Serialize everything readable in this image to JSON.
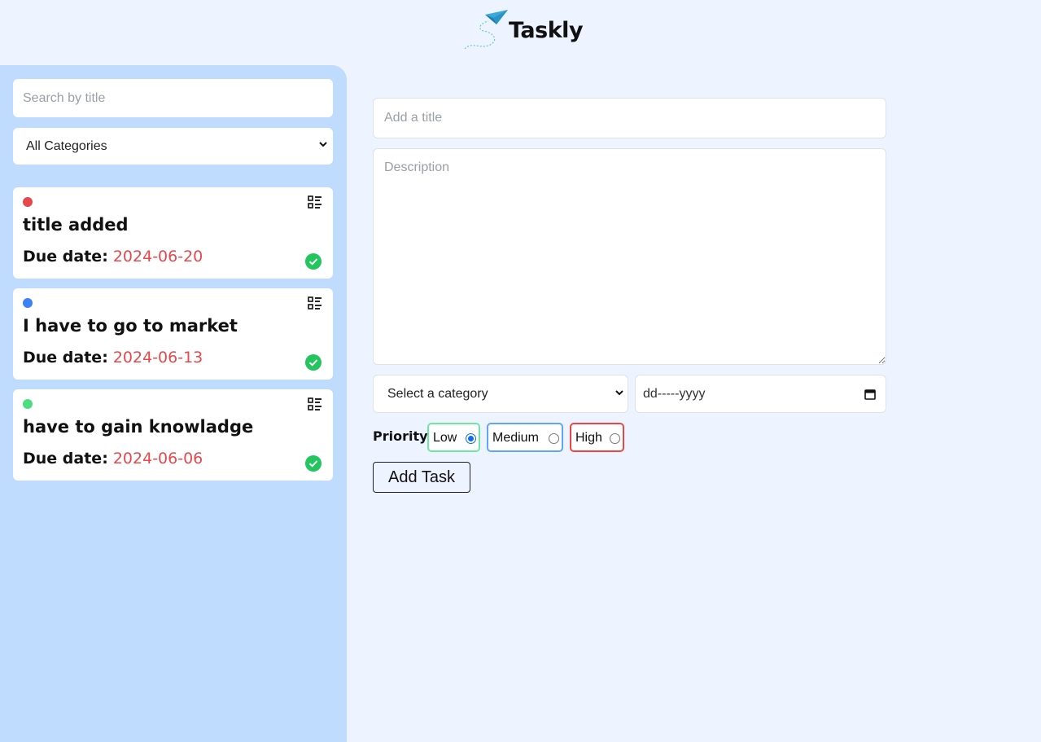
{
  "header": {
    "app_name": "Taskly",
    "logo_icon": "paper-plane-icon"
  },
  "sidebar": {
    "search": {
      "placeholder": "Search by title",
      "value": ""
    },
    "category_filter": {
      "selected": "All Categories"
    },
    "tasks": [
      {
        "priority_color": "#e5484d",
        "title": "title added",
        "due_label": "Due date:",
        "due_date": "2024-06-20"
      },
      {
        "priority_color": "#3b82f6",
        "title": "I have to go to market",
        "due_label": "Due date:",
        "due_date": "2024-06-13"
      },
      {
        "priority_color": "#4ade80",
        "title": "have to gain knowladge",
        "due_label": "Due date:",
        "due_date": "2024-06-06"
      }
    ]
  },
  "form": {
    "title": {
      "placeholder": "Add a title",
      "value": ""
    },
    "description": {
      "placeholder": "Description",
      "value": ""
    },
    "category": {
      "selected": "Select a category"
    },
    "date": {
      "placeholder": "dd-----yyyy"
    },
    "priority": {
      "label": "Priority:",
      "options": [
        {
          "label": "Low",
          "checked": true,
          "color": "#6ee7a0"
        },
        {
          "label": "Medium",
          "checked": false,
          "color": "#60a5fa"
        },
        {
          "label": "High",
          "checked": false,
          "color": "#ef4444"
        }
      ]
    },
    "submit_label": "Add Task"
  },
  "colors": {
    "background": "#eef4ff",
    "sidebar": "#bfdbfe",
    "due_date": "#e5484d",
    "done": "#22c55e"
  }
}
